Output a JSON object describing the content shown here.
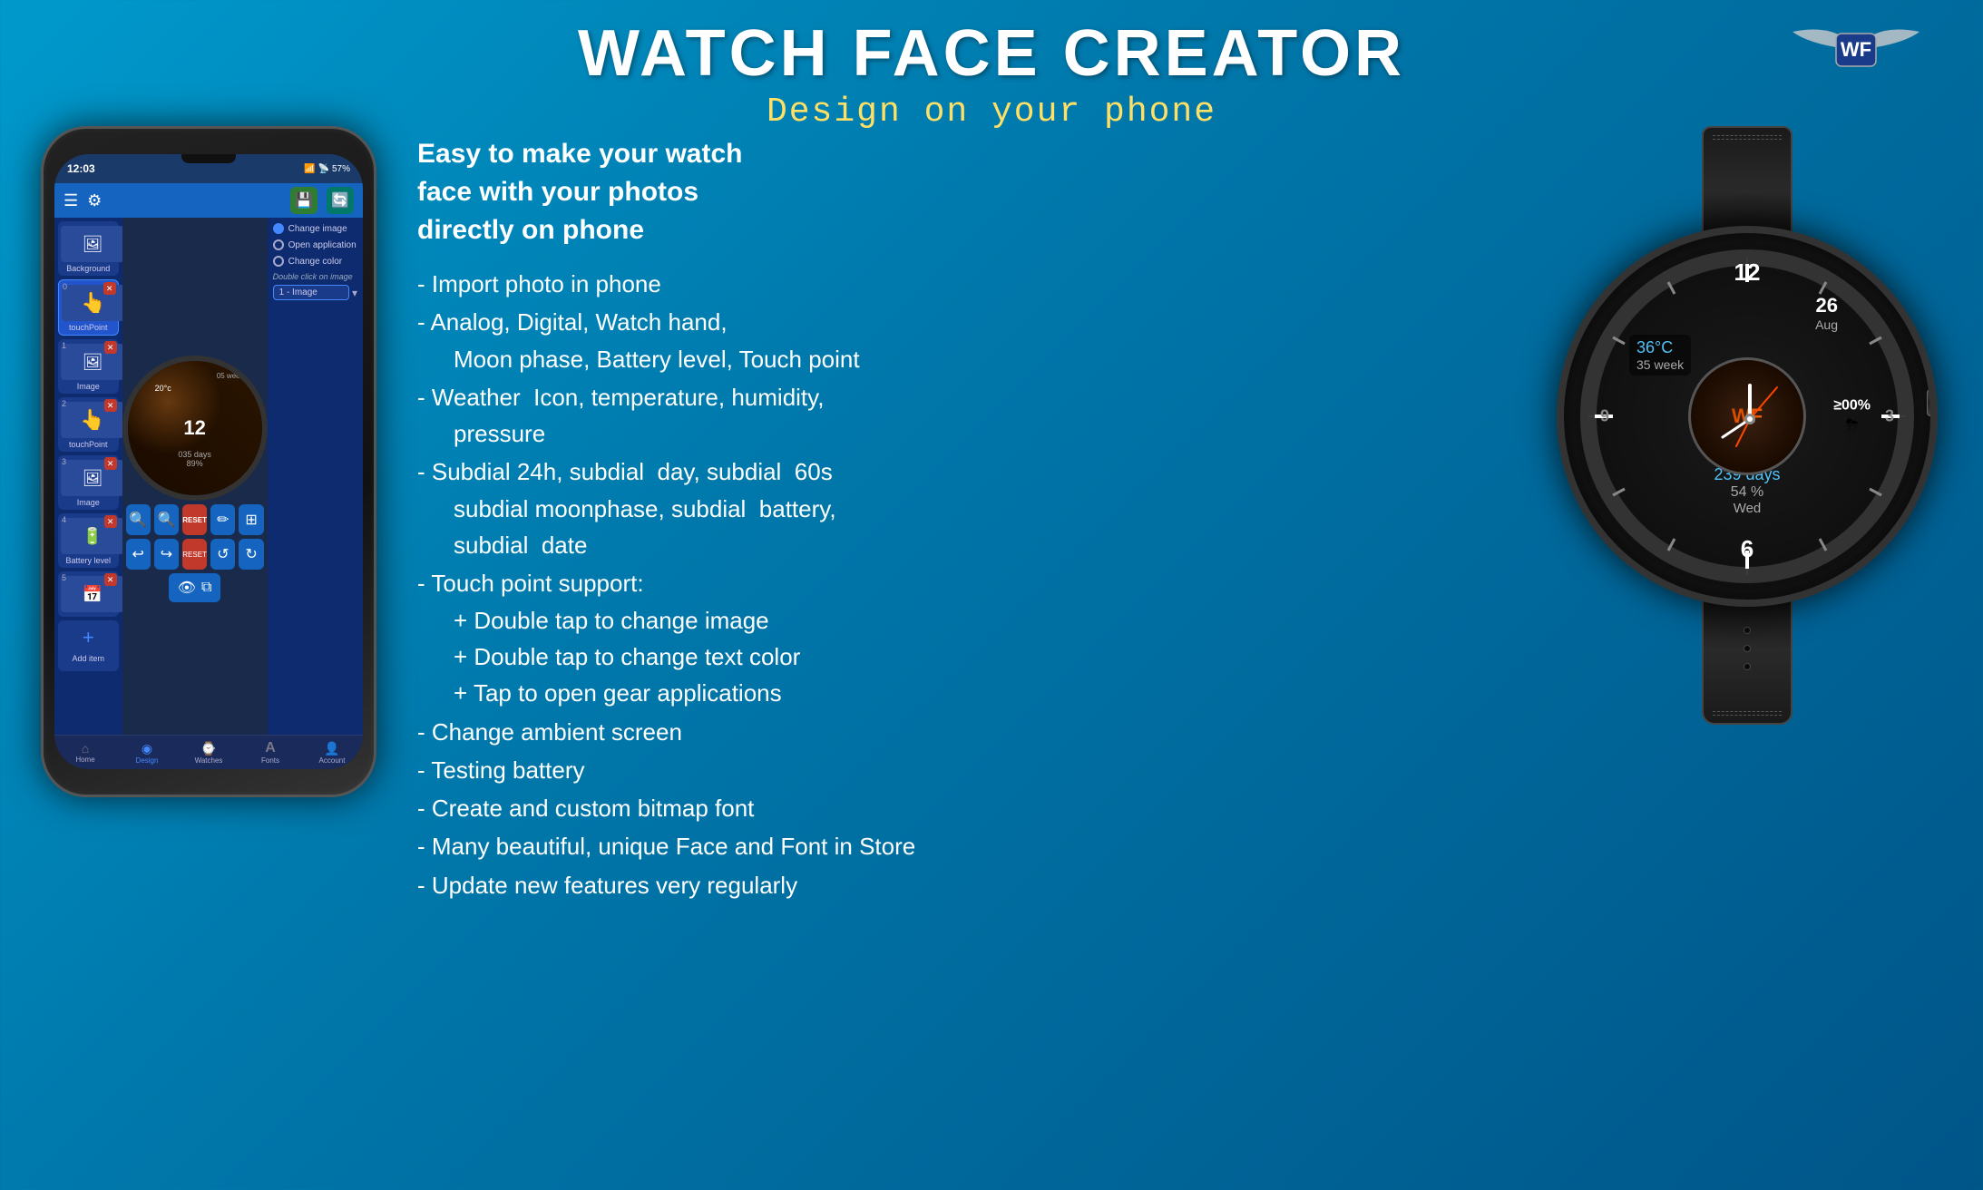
{
  "app": {
    "title": "WATCH FACE CREATOR",
    "subtitle": "Design on your phone",
    "logo_text": "WF"
  },
  "intro": {
    "line1": "Easy to make your watch",
    "line2": "face with your photos",
    "line3": "directly on phone"
  },
  "features": [
    "- Import photo in phone",
    "- Analog, Digital, Watch hand,",
    "  Moon phase, Battery level, Touch point",
    "- Weather  Icon, temperature, humidity,",
    "  pressure",
    "- Subdial 24h, subdial  day, subdial  60s",
    "  subdial moonphase, subdial  battery,",
    "  subdial  date",
    "- Touch point support:",
    "  + Double tap to change image",
    "  + Double tap to change text color",
    "  + Tap to open gear applications",
    "- Change ambient screen",
    "- Testing battery",
    "- Create and custom bitmap font",
    "- Many beautiful, unique Face and Font in Store",
    "- Update new features very regularly"
  ],
  "phone": {
    "status_time": "12:03",
    "status_battery": "57%",
    "layers": [
      {
        "num": "",
        "label": "Background",
        "icon": "🖼",
        "active": false
      },
      {
        "num": "0",
        "label": "touchPoint",
        "icon": "👆",
        "active": true
      },
      {
        "num": "1",
        "label": "Image",
        "icon": "🖼",
        "active": false
      },
      {
        "num": "2",
        "label": "touchPoint",
        "icon": "👆",
        "active": false
      },
      {
        "num": "3",
        "label": "Image",
        "icon": "🖼",
        "active": false
      },
      {
        "num": "4",
        "label": "Battery level",
        "icon": "🔋",
        "active": false
      },
      {
        "num": "5",
        "label": "Add item",
        "icon": "+",
        "active": false
      }
    ],
    "touch_options": [
      {
        "label": "Change image",
        "selected": true
      },
      {
        "label": "Open application",
        "selected": false
      },
      {
        "label": "Change color",
        "selected": false
      }
    ],
    "double_click_label": "Double click on image",
    "dropdown_value": "1 - Image",
    "bottom_nav": [
      {
        "label": "Home",
        "icon": "⌂",
        "active": false
      },
      {
        "label": "Design",
        "icon": "◉",
        "active": true
      },
      {
        "label": "Watches",
        "icon": "⌚",
        "active": false
      },
      {
        "label": "Fonts",
        "icon": "A",
        "active": false
      },
      {
        "label": "Account",
        "icon": "👤",
        "active": false
      }
    ]
  },
  "big_watch": {
    "hour_12": "12",
    "hour_6": "6",
    "date_num": "26",
    "month_str": "Aug",
    "temperature": "36°C",
    "week": "35 week",
    "days": "239 days",
    "battery_pct": "54 %",
    "battery_pct2": "≥00%",
    "day_label": "Wed"
  }
}
